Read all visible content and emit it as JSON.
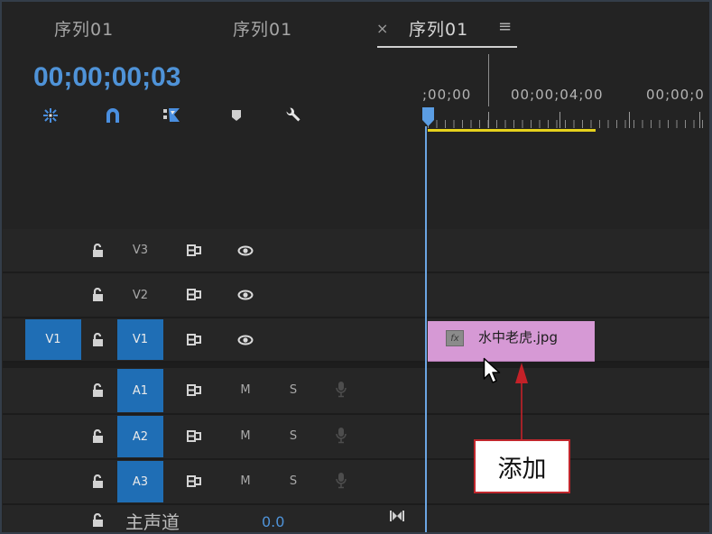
{
  "colors": {
    "background": "#232323",
    "track_background": "#262626",
    "accent_blue": "#4f93d8",
    "target_blue": "#1f6eb5",
    "clip_pink": "#d699d5",
    "work_area_yellow": "#e6d21c",
    "callout_red": "#c0272d"
  },
  "tabs": [
    {
      "label": "序列01",
      "active": false
    },
    {
      "label": "序列01",
      "active": false
    },
    {
      "label": "序列01",
      "active": true,
      "close": "×",
      "menu": "≡"
    }
  ],
  "timecode": "00;00;00;03",
  "toolbar": [
    {
      "icon": "nest-insert-icon"
    },
    {
      "icon": "snap-magnet-icon"
    },
    {
      "icon": "linked-selection-icon"
    },
    {
      "icon": "add-marker-icon"
    },
    {
      "icon": "wrench-settings-icon"
    }
  ],
  "ruler": {
    "labels": [
      ";00;00",
      "00;00;04;00",
      "00;00;0"
    ]
  },
  "video_tracks": [
    {
      "name": "V3",
      "targeted": false
    },
    {
      "name": "V2",
      "targeted": false
    },
    {
      "name": "V1",
      "targeted": true,
      "source": "V1"
    }
  ],
  "audio_tracks": [
    {
      "name": "A1",
      "targeted": true,
      "mute": "M",
      "solo": "S"
    },
    {
      "name": "A2",
      "targeted": true,
      "mute": "M",
      "solo": "S"
    },
    {
      "name": "A3",
      "targeted": true,
      "mute": "M",
      "solo": "S"
    }
  ],
  "track_icons": {
    "lock": "lock-open-icon",
    "sync": "sync-lock-icon",
    "visibility": "eye-icon",
    "voiceover": "microphone-icon"
  },
  "master": {
    "label": "主声道",
    "value": "0.0"
  },
  "clip": {
    "name": "水中老虎.jpg",
    "badge": "fx"
  },
  "callout": {
    "label": "添加"
  }
}
